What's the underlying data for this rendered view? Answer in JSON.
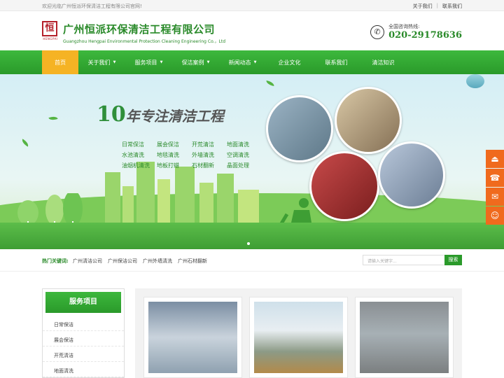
{
  "topbar": {
    "welcome": "欢迎光临广州恒派环保清洁工程有限公司官网!",
    "about_link": "关于我们",
    "contact_link": "联系我们"
  },
  "header": {
    "logo_mark": "恒",
    "logo_sub": "HENGPAI",
    "company_cn": "广州恒派环保清洁工程有限公司",
    "company_en": "Guangzhou Hengpai Environmental Protection Cleaning Engineering Co.，Ltd",
    "hotline_label": "全国咨询热线:",
    "hotline_number": "020-29178636"
  },
  "nav": {
    "items": [
      {
        "label": "首页",
        "active": true,
        "has_caret": false
      },
      {
        "label": "关于我们",
        "has_caret": true
      },
      {
        "label": "服务项目",
        "has_caret": true
      },
      {
        "label": "保洁案例",
        "has_caret": true
      },
      {
        "label": "新闻动态",
        "has_caret": true
      },
      {
        "label": "企业文化",
        "has_caret": false
      },
      {
        "label": "联系我们",
        "has_caret": false
      },
      {
        "label": "清洁知识",
        "has_caret": false
      }
    ]
  },
  "banner": {
    "title_num": "10",
    "title_text": "年专注清洁工程",
    "services": [
      "日常保洁",
      "展会保洁",
      "开荒清洁",
      "地面清洗",
      "水池清洗",
      "地毯清洗",
      "外墙清洗",
      "空调清洗",
      "油烟机清洗",
      "地板打蜡",
      "石材翻新",
      "晶面处理"
    ]
  },
  "side_tools": [
    "top-icon",
    "phone-icon",
    "message-icon",
    "qq-icon"
  ],
  "hot": {
    "label": "热门关键词:",
    "keywords": [
      "广州清洁公司",
      "广州保洁公司",
      "广州外墙清洗",
      "广州石材翻新"
    ],
    "search_placeholder": "请输入关键字...",
    "search_button": "搜索"
  },
  "sidebar": {
    "title": "服务项目",
    "items": [
      "日常保洁",
      "展会保洁",
      "开荒清洁",
      "地面清洗"
    ]
  },
  "colors": {
    "brand_green": "#2a9a2a",
    "accent_orange": "#f5b324",
    "logo_red": "#b5202b"
  }
}
